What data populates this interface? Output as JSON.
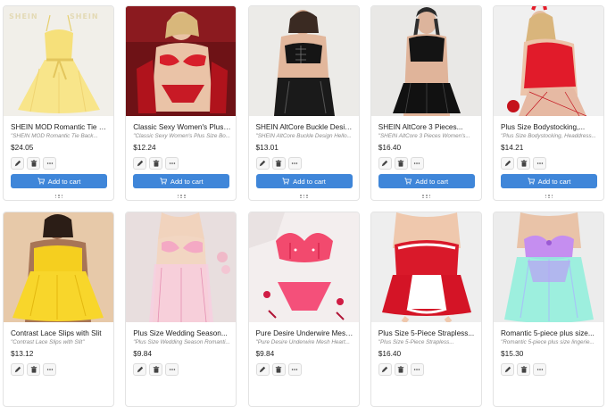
{
  "card_labels": {
    "add_to_cart": "Add to cart"
  },
  "icons": {
    "edit": "pencil-icon",
    "delete": "trash-icon",
    "more": "ellipsis-icon",
    "cart": "cart-icon",
    "grip": "drag-handle-icon"
  },
  "colors": {
    "button": "#3f86d9",
    "price": "#222222",
    "subtitle": "#8a8a8a"
  },
  "products": [
    {
      "title": "SHEIN MOD Romantic Tie Back...",
      "subtitle": "\"SHEIN MOD Romantic Tie Back...",
      "price": "$24.05",
      "image_text": "SHEIN"
    },
    {
      "title": "Classic Sexy Women's Plus Siz...",
      "subtitle": "\"Classic Sexy Women's Plus Size Bo...",
      "price": "$12.24"
    },
    {
      "title": "SHEIN AltCore Buckle Design...",
      "subtitle": "\"SHEIN AltCore Buckle Design Hello...",
      "price": "$13.01"
    },
    {
      "title": "SHEIN AltCore 3 Pieces...",
      "subtitle": "\"SHEIN AltCore 3 Pieces Women's...",
      "price": "$16.40"
    },
    {
      "title": "Plus Size Bodystocking,...",
      "subtitle": "\"Plus Size Bodystocking, Headdress...",
      "price": "$14.21"
    },
    {
      "title": "Contrast Lace Slips with Slit",
      "subtitle": "\"Contrast Lace Slips with Slit\"",
      "price": "$13.12"
    },
    {
      "title": "Plus Size Wedding Season...",
      "subtitle": "\"Plus Size Wedding Season Romanti...",
      "price": "$9.84"
    },
    {
      "title": "Pure Desire Underwire Mesh...",
      "subtitle": "\"Pure Desire Underwire Mesh Heart...",
      "price": "$9.84"
    },
    {
      "title": "Plus Size 5-Piece Strapless...",
      "subtitle": "\"Plus Size 5-Piece Strapless...",
      "price": "$16.40"
    },
    {
      "title": "Romantic 5-piece plus size...",
      "subtitle": "\"Romantic 5-piece plus size lingerie...",
      "price": "$15.30"
    }
  ]
}
